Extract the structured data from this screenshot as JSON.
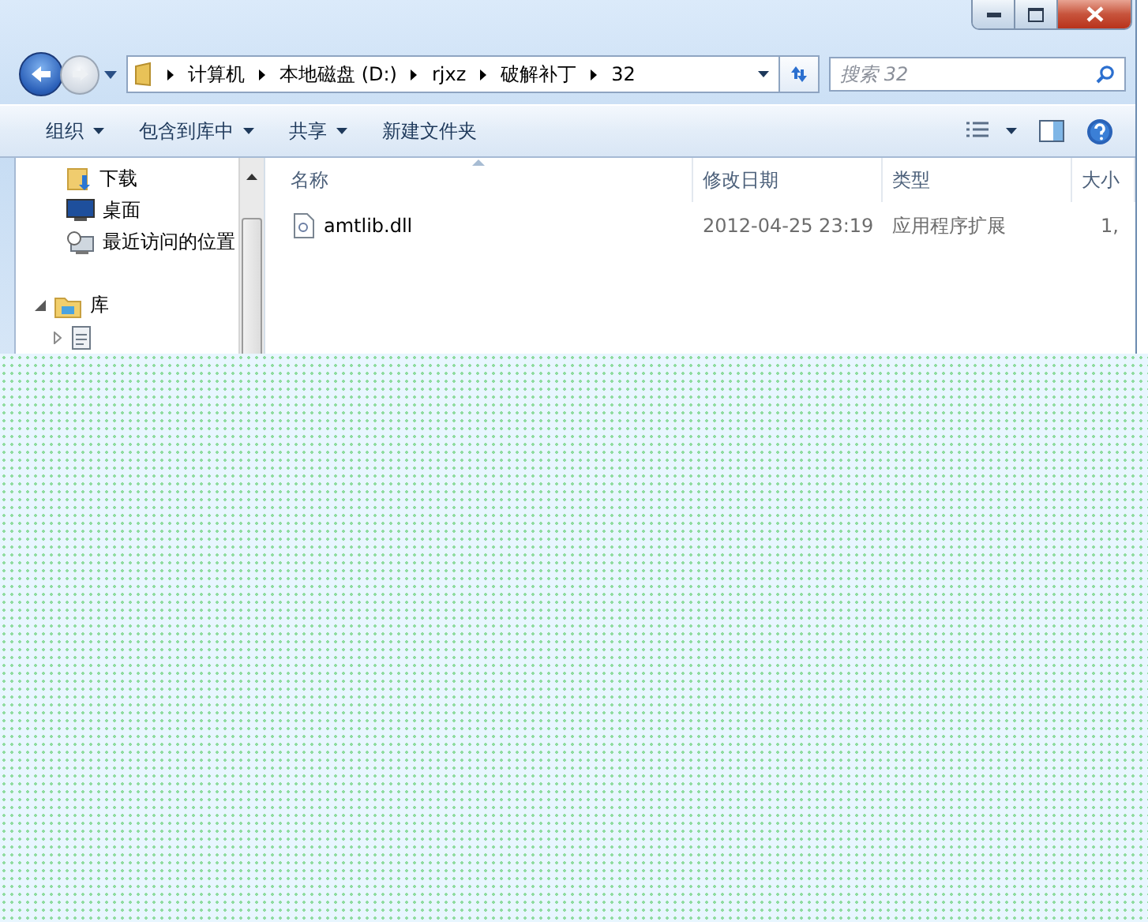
{
  "address": {
    "crumbs": [
      "计算机",
      "本地磁盘 (D:)",
      "rjxz",
      "破解补丁",
      "32"
    ]
  },
  "search": {
    "placeholder": "搜索 32"
  },
  "toolbar": {
    "items": [
      {
        "label": "组织",
        "dropdown": true
      },
      {
        "label": "包含到库中",
        "dropdown": true
      },
      {
        "label": "共享",
        "dropdown": true
      },
      {
        "label": "新建文件夹",
        "dropdown": false
      }
    ]
  },
  "nav_pane": {
    "items": [
      {
        "kind": "downloads",
        "label": "下载"
      },
      {
        "kind": "desktop",
        "label": "桌面"
      },
      {
        "kind": "recent",
        "label": "最近访问的位置"
      },
      {
        "kind": "library",
        "label": "库",
        "expanded": true
      },
      {
        "kind": "document-library",
        "expanded": false
      }
    ]
  },
  "file_list": {
    "columns": [
      {
        "label": "名称",
        "sorted": true
      },
      {
        "label": "修改日期",
        "sorted": false
      },
      {
        "label": "类型",
        "sorted": false
      },
      {
        "label": "大小",
        "sorted": false
      }
    ],
    "rows": [
      {
        "cells": [
          "amtlib.dll",
          "2012-04-25 23:19",
          "应用程序扩展",
          "1,"
        ],
        "selected": false
      }
    ]
  }
}
